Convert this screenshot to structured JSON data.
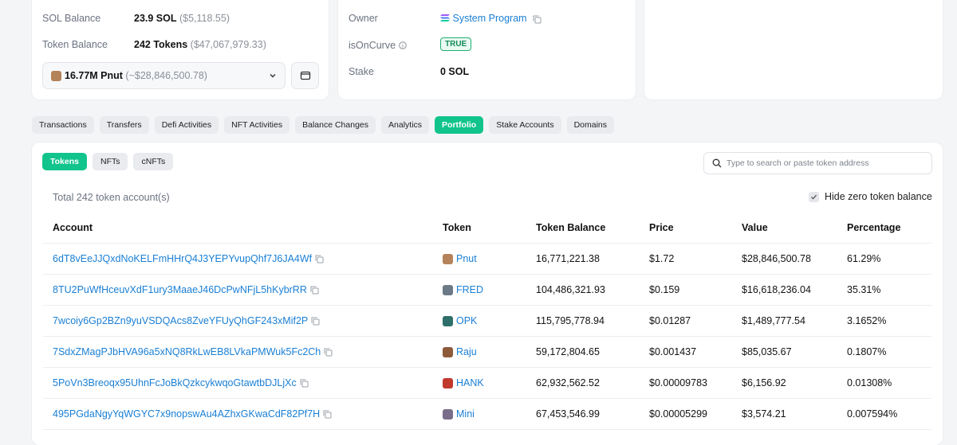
{
  "balance_card": {
    "sol_label": "SOL Balance",
    "sol_value": "23.9 SOL",
    "sol_usd": "($5,118.55)",
    "token_label": "Token Balance",
    "token_value": "242 Tokens",
    "token_usd": "($47,067,979.33)",
    "selected_token": "16.77M Pnut",
    "selected_token_usd": "(~$28,846,500.78)"
  },
  "owner_card": {
    "owner_label": "Owner",
    "owner_value": "System Program",
    "oncurve_label": "isOnCurve",
    "oncurve_value": "TRUE",
    "stake_label": "Stake",
    "stake_value": "0 SOL"
  },
  "tabs": [
    "Transactions",
    "Transfers",
    "Defi Activities",
    "NFT Activities",
    "Balance Changes",
    "Analytics",
    "Portfolio",
    "Stake Accounts",
    "Domains"
  ],
  "active_tab": "Portfolio",
  "subtabs": [
    "Tokens",
    "NFTs",
    "cNFTs"
  ],
  "search": {
    "placeholder": "Type to search or paste token address"
  },
  "total_text": "Total 242 token account(s)",
  "hide_zero_label": "Hide zero token balance",
  "table": {
    "headers": [
      "Account",
      "Token",
      "Token Balance",
      "Price",
      "Value",
      "Percentage"
    ],
    "rows": [
      {
        "account": "6dT8vEeJJQxdNoKELFmHHrQ4J3YEPYvupQhf7J6JA4Wf",
        "token": "Pnut",
        "balance": "16,771,221.38",
        "price": "$1.72",
        "value": "$28,846,500.78",
        "pct": "61.29%",
        "color": "#b5835a"
      },
      {
        "account": "8TU2PuWfHceuvXdF1ury3MaaeJ46DcPwNFjL5hKybrRR",
        "token": "FRED",
        "balance": "104,486,321.93",
        "price": "$0.159",
        "value": "$16,618,236.04",
        "pct": "35.31%",
        "color": "#6b7a86"
      },
      {
        "account": "7wcoiy6Gp2BZn9yuVSDQAcs8ZveYFUyQhGF243xMif2P",
        "token": "OPK",
        "balance": "115,795,778.94",
        "price": "$0.01287",
        "value": "$1,489,777.54",
        "pct": "3.1652%",
        "color": "#2f6f6a"
      },
      {
        "account": "7SdxZMagPJbHVA96a5xNQ8RkLwEB8LVkaPMWuk5Fc2Ch",
        "token": "Raju",
        "balance": "59,172,804.65",
        "price": "$0.001437",
        "value": "$85,035.67",
        "pct": "0.1807%",
        "color": "#8d5b3a"
      },
      {
        "account": "5PoVn3Breoqx95UhnFcJoBkQzkcykwqoGtawtbDJLjXc",
        "token": "HANK",
        "balance": "62,932,562.52",
        "price": "$0.00009783",
        "value": "$6,156.92",
        "pct": "0.01308%",
        "color": "#c0392b"
      },
      {
        "account": "495PGdaNgyYqWGYC7x9nopswAu4AZhxGKwaCdF82Pf7H",
        "token": "Mini",
        "balance": "67,453,546.99",
        "price": "$0.00005299",
        "value": "$3,574.21",
        "pct": "0.007594%",
        "color": "#7a6d8a"
      }
    ]
  },
  "colors": {
    "accent": "#11c48b",
    "link": "#1a7fd4"
  },
  "icons": [
    "solana-icon",
    "copy-icon",
    "info-icon",
    "chevron-down-icon",
    "wallet-icon",
    "search-icon",
    "check-icon"
  ]
}
